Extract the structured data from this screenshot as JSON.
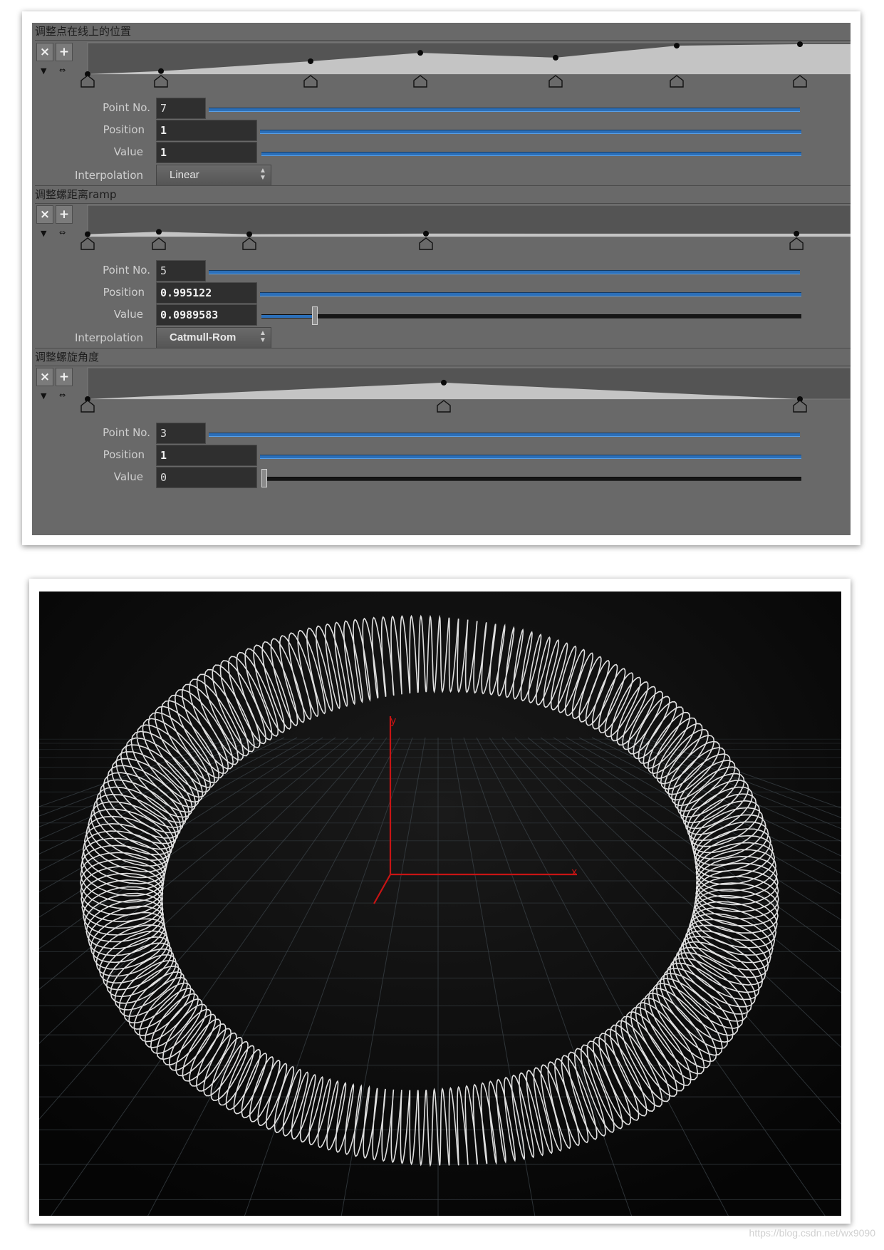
{
  "sections": [
    {
      "title": "调整点在线上的位置",
      "point_no_label": "Point No.",
      "point_no": "7",
      "position_label": "Position",
      "position": "1",
      "value_label": "Value",
      "value": "1",
      "value_level": 1,
      "interpolation_label": "Interpolation",
      "interpolation": "Linear",
      "ramp_points": [
        {
          "pos": 0.0,
          "val": 0.0
        },
        {
          "pos": 0.103,
          "val": 0.1
        },
        {
          "pos": 0.313,
          "val": 0.43
        },
        {
          "pos": 0.467,
          "val": 0.71
        },
        {
          "pos": 0.657,
          "val": 0.55
        },
        {
          "pos": 0.827,
          "val": 0.95
        },
        {
          "pos": 1.0,
          "val": 1.0
        }
      ]
    },
    {
      "title": "调整螺距离ramp",
      "point_no_label": "Point No.",
      "point_no": "5",
      "position_label": "Position",
      "position": "0.995122",
      "value_label": "Value",
      "value": "0.0989583",
      "value_level": 0.0989583,
      "interpolation_label": "Interpolation",
      "interpolation": "Catmull-Rom",
      "ramp_points": [
        {
          "pos": 0.0,
          "val": 0.08
        },
        {
          "pos": 0.1,
          "val": 0.16
        },
        {
          "pos": 0.227,
          "val": 0.08
        },
        {
          "pos": 0.475,
          "val": 0.1
        },
        {
          "pos": 0.995122,
          "val": 0.0989583
        }
      ]
    },
    {
      "title": "调整螺旋角度",
      "point_no_label": "Point No.",
      "point_no": "3",
      "position_label": "Position",
      "position": "1",
      "value_label": "Value",
      "value": "0",
      "value_level": 0,
      "ramp_points": [
        {
          "pos": 0.0,
          "val": 0.0
        },
        {
          "pos": 0.5,
          "val": 0.55
        },
        {
          "pos": 1.0,
          "val": 0.0
        }
      ]
    }
  ],
  "buttons": {
    "delete": "×",
    "add": "+"
  },
  "icons": {
    "collapse": "collapse-triangle-icon",
    "expand": "expand-icon"
  },
  "viewport": {
    "axis_x": "x",
    "axis_y": "y"
  },
  "watermark": "https://blog.csdn.net/wx9090",
  "colors": {
    "slider": "#2c6fb8",
    "axis": "#d01818",
    "spring": "#ffffff",
    "panel": "#696969"
  }
}
